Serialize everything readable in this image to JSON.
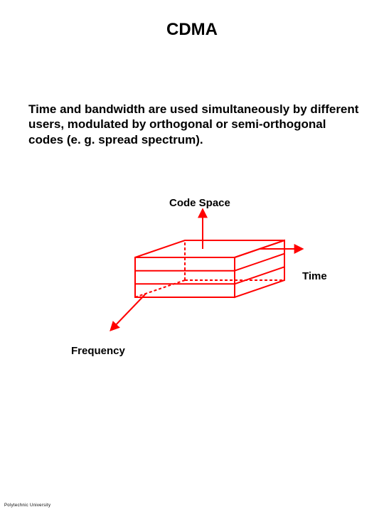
{
  "title": "CDMA",
  "body": "Time and bandwidth are used simultaneously by different users, modulated by orthogonal or semi-orthogonal codes (e. g. spread spectrum).",
  "labels": {
    "code_space": "Code Space",
    "time": "Time",
    "frequency": "Frequency"
  },
  "footer": "Polytechnic University",
  "diagram": {
    "axes": [
      "Code Space",
      "Time",
      "Frequency"
    ],
    "layers": 3,
    "color": "#ff0000"
  }
}
